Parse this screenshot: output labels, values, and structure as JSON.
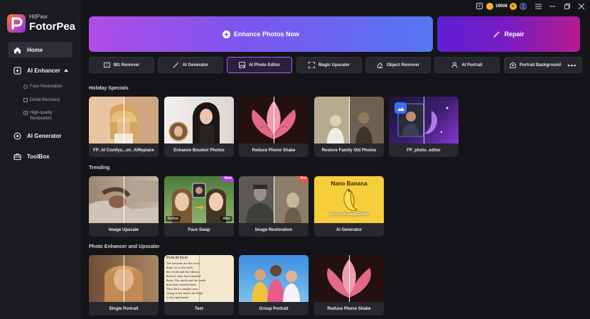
{
  "app": {
    "brand": "HitPaw",
    "product": "FotorPea"
  },
  "sidebar": {
    "items": [
      {
        "label": "Home",
        "icon": "home-icon"
      },
      {
        "label": "AI Enhancer",
        "icon": "sparkle-icon"
      },
      {
        "label": "AI Generator",
        "icon": "generator-icon"
      },
      {
        "label": "ToolBox",
        "icon": "toolbox-icon"
      }
    ],
    "subitems": [
      {
        "label": "Face Restoration",
        "icon": "face-icon"
      },
      {
        "label": "Detail Recovery",
        "icon": "detail-icon"
      },
      {
        "label": "High-quality Restoration",
        "icon": "quality-icon"
      }
    ]
  },
  "topbar": {
    "coins": "19008"
  },
  "hero": {
    "enhance_label": "Enhance Photos Now",
    "repair_label": "Repair"
  },
  "tools": [
    {
      "label": "BG Remover",
      "icon": "bg-remover-icon"
    },
    {
      "label": "AI Generator",
      "icon": "magic-wand-icon"
    },
    {
      "label": "AI Photo Editor",
      "icon": "photo-editor-icon"
    },
    {
      "label": "Magic Upscaler",
      "icon": "upscale-icon"
    },
    {
      "label": "Object Remover",
      "icon": "eraser-icon"
    },
    {
      "label": "AI Portrait",
      "icon": "portrait-icon"
    },
    {
      "label": "Portrait Background",
      "icon": "background-icon"
    }
  ],
  "sections": [
    {
      "title": "Holiday Specials",
      "cards": [
        {
          "label": "FP_AI Comfyu...on_AIReplace"
        },
        {
          "label": "Enhance Boudoir Photos"
        },
        {
          "label": "Reduce Phone Shake"
        },
        {
          "label": "Restore Family Old Photos"
        },
        {
          "label": "FP_photo_editor"
        }
      ]
    },
    {
      "title": "Trending",
      "cards": [
        {
          "label": "Image Upscale"
        },
        {
          "label": "Face Swap",
          "badge": "New",
          "before": "Before",
          "after": "After"
        },
        {
          "label": "Image Restoration",
          "badge": "Hot"
        },
        {
          "label": "AI Generator",
          "art_title": "Nano Banana",
          "art_caption": "Source of Image Editor"
        }
      ]
    },
    {
      "title": "Photo Enhancer and Upscaler",
      "cards": [
        {
          "label": "Single Portrait"
        },
        {
          "label": "Text",
          "doc_title": "PSALM 93:11",
          "doc_lines": [
            "The heavens are the work",
            "thine; so is the earth",
            "the world and the fulness",
            "thereof, thou hast founded",
            "them. The north and the south",
            "thou hast created them.",
            "Thou hast a mighty arm,",
            "strong is thy hand, and high",
            "is thy right hand."
          ]
        },
        {
          "label": "Group Portrait"
        },
        {
          "label": "Reduce Phone Shake"
        }
      ]
    }
  ]
}
